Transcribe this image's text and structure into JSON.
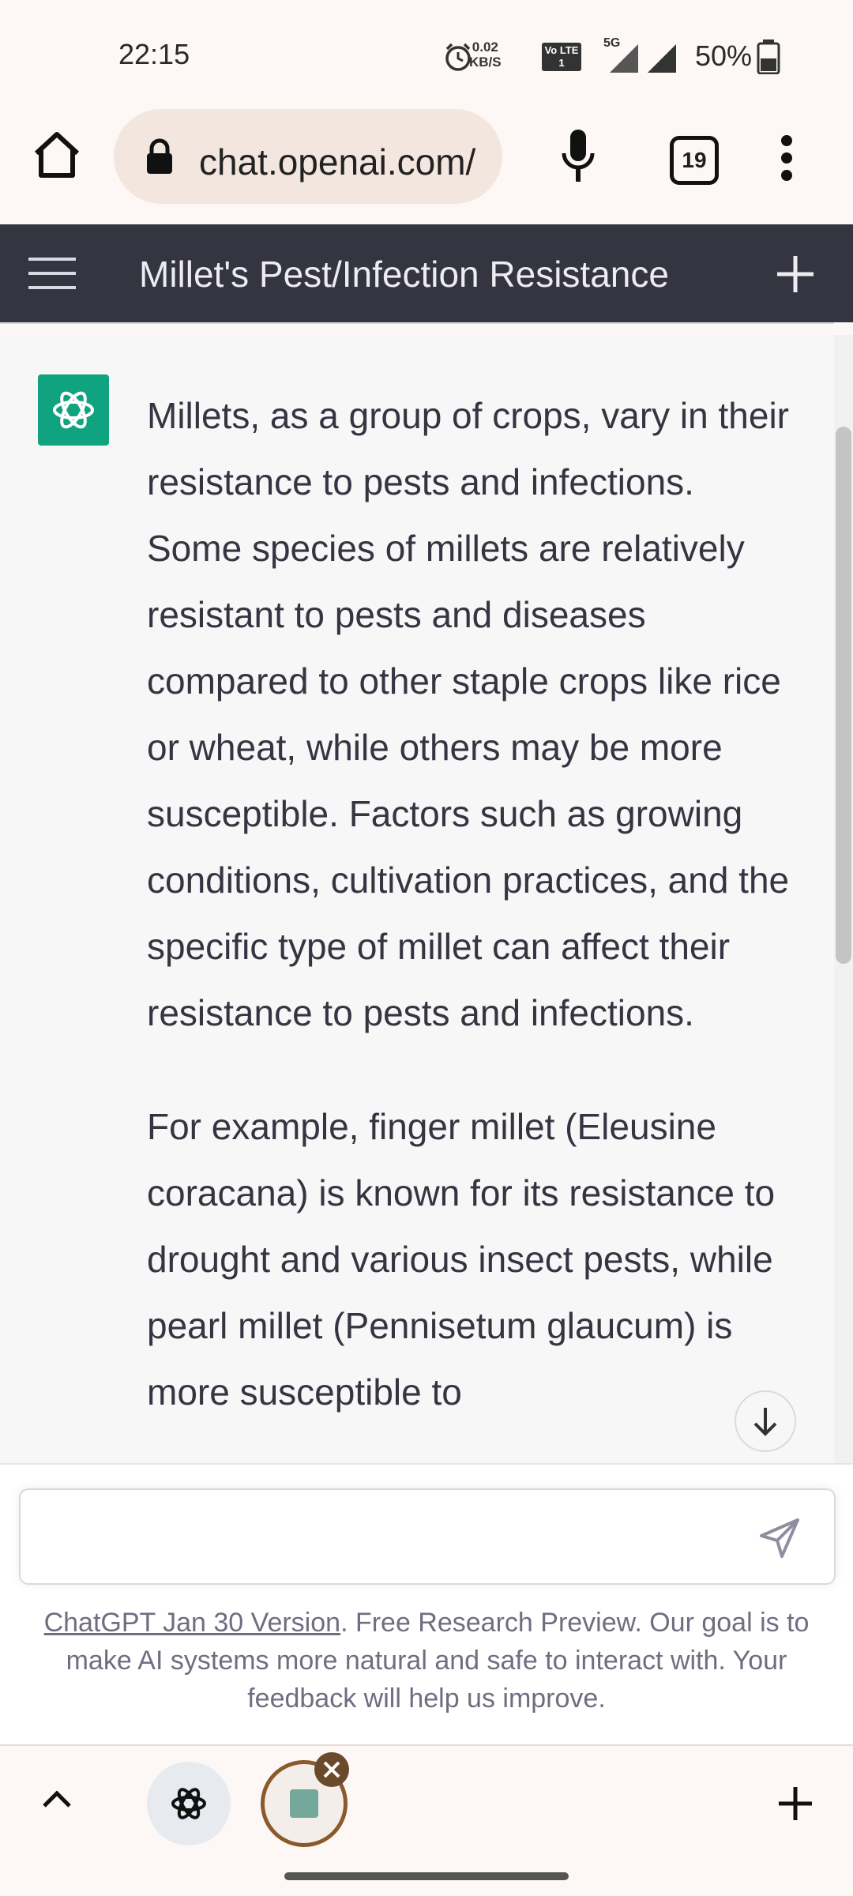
{
  "status_bar": {
    "time": "22:15",
    "network_speed": "0.02",
    "network_speed_unit": "KB/S",
    "network_type": "5G",
    "volte_label": "Vo LTE 1",
    "battery": "50%"
  },
  "browser": {
    "url": "chat.openai.com/",
    "tab_count": "19",
    "icons": [
      "home-icon",
      "lock-icon",
      "mic-icon",
      "tab-switcher-icon",
      "menu-kebab-icon"
    ]
  },
  "chat_header": {
    "title": "Millet's Pest/Infection Resistance",
    "icons": [
      "hamburger-menu-icon",
      "new-chat-plus-icon"
    ]
  },
  "message": {
    "paragraph_1": "Millets, as a group of crops, vary in their resistance to pests and infections. Some species of millets are relatively resistant to pests and diseases compared to other staple crops like rice or wheat, while others may be more susceptible. Factors such as growing conditions, cultivation practices, and the specific type of millet can affect their resistance to pests and infections.",
    "paragraph_2": "For example, finger millet (Eleusine coracana) is known for its resistance to drought and various insect pests, while pearl millet (Pennisetum glaucum) is more susceptible to"
  },
  "input": {
    "placeholder": "",
    "value": ""
  },
  "footer": {
    "link_text": "ChatGPT Jan 30 Version",
    "text": ". Free Research Preview. Our goal is to make AI systems more natural and safe to interact with. Your feedback will help us improve."
  },
  "colors": {
    "header_bg": "#343541",
    "brand_green": "#10a37f",
    "content_bg": "#f7f7f8",
    "browser_bg": "#fdf8f5"
  }
}
